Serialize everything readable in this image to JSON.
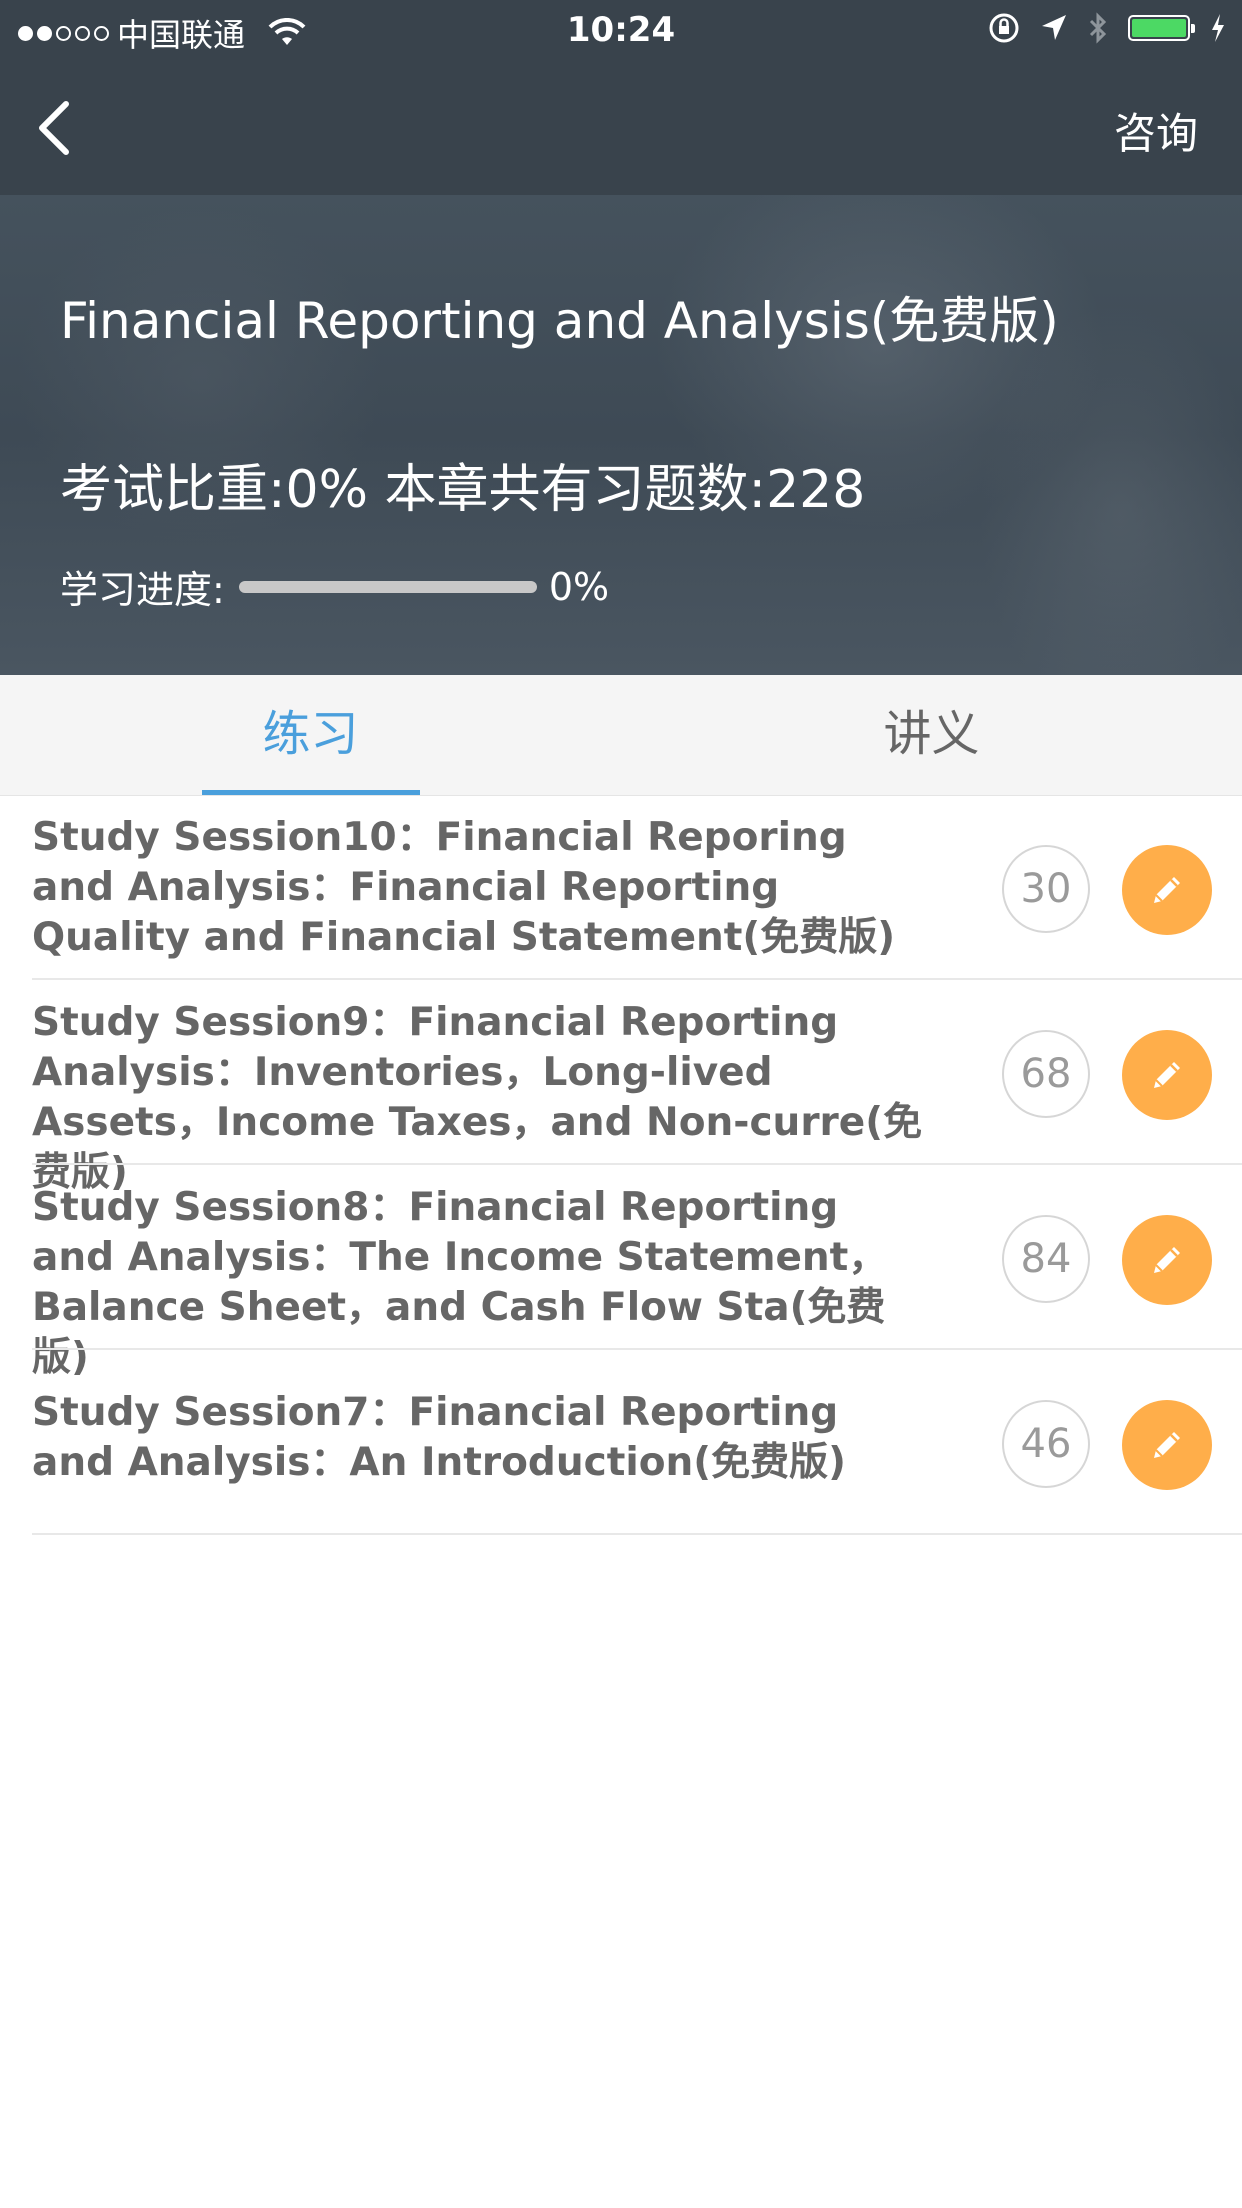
{
  "status_bar": {
    "carrier": "中国联通",
    "time": "10:24"
  },
  "nav": {
    "consult_label": "咨询"
  },
  "hero": {
    "title": "Financial Reporting and Analysis(免费版)",
    "stats": "考试比重:0% 本章共有习题数:228",
    "progress_label": "学习进度:",
    "progress_value": "0%",
    "progress_fraction": 0
  },
  "tabs": [
    {
      "label": "练习",
      "active": true
    },
    {
      "label": "讲义",
      "active": false
    }
  ],
  "sessions": [
    {
      "title": "Study Session10：Financial Reporing and Analysis：Financial Reporting Quality and Financial Statement(免费版)",
      "count": "30"
    },
    {
      "title": "Study Session9：Financial Reporting Analysis：Inventories，Long-lived Assets，Income Taxes，and Non-curre(免费版)",
      "count": "68"
    },
    {
      "title": "Study Session8：Financial Reporting and Analysis：The Income Statement，Balance Sheet，and Cash Flow Sta(免费版)",
      "count": "84"
    },
    {
      "title": "Study Session7：Financial Reporting and Analysis：An Introduction(免费版)",
      "count": "46"
    }
  ],
  "colors": {
    "accent": "#4a9fdc",
    "edit_button": "#ffae4a",
    "header_bg": "#39434c"
  },
  "icons": {
    "back": "chevron-left-icon",
    "edit": "pencil-icon"
  }
}
